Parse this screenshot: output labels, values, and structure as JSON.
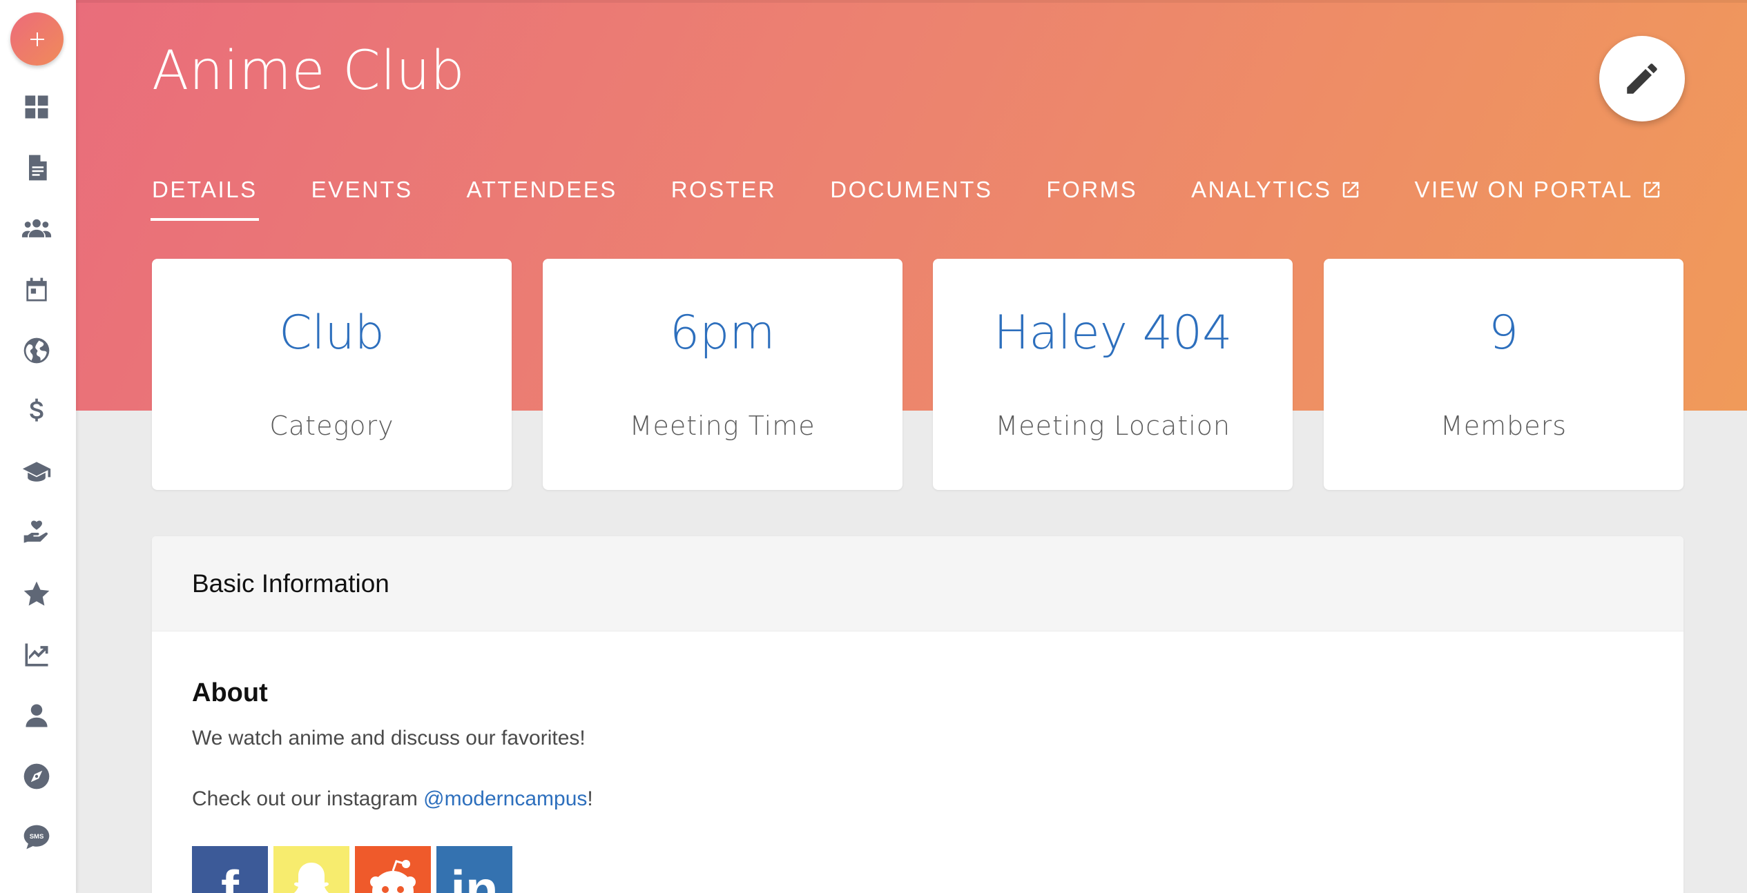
{
  "sidebar": {
    "add_icon": "plus-icon",
    "items": [
      {
        "name": "dashboard",
        "icon": "dashboard-icon"
      },
      {
        "name": "documents",
        "icon": "document-icon"
      },
      {
        "name": "groups",
        "icon": "groups-icon"
      },
      {
        "name": "calendar",
        "icon": "calendar-icon"
      },
      {
        "name": "globe",
        "icon": "globe-icon"
      },
      {
        "name": "finance",
        "icon": "dollar-icon"
      },
      {
        "name": "education",
        "icon": "graduation-cap-icon"
      },
      {
        "name": "volunteer",
        "icon": "hand-heart-icon"
      },
      {
        "name": "favorites",
        "icon": "star-icon"
      },
      {
        "name": "analytics",
        "icon": "trending-up-icon"
      },
      {
        "name": "profile",
        "icon": "person-icon"
      },
      {
        "name": "explore",
        "icon": "compass-icon"
      },
      {
        "name": "sms",
        "icon": "sms-icon"
      }
    ]
  },
  "header": {
    "title": "Anime Club",
    "edit_icon": "pencil-icon",
    "colors": {
      "gradient_start": "#e96d7b",
      "gradient_end": "#f09a5a"
    }
  },
  "tabs": [
    {
      "label": "DETAILS",
      "active": true,
      "external": false
    },
    {
      "label": "EVENTS",
      "active": false,
      "external": false
    },
    {
      "label": "ATTENDEES",
      "active": false,
      "external": false
    },
    {
      "label": "ROSTER",
      "active": false,
      "external": false
    },
    {
      "label": "DOCUMENTS",
      "active": false,
      "external": false
    },
    {
      "label": "FORMS",
      "active": false,
      "external": false
    },
    {
      "label": "ANALYTICS",
      "active": false,
      "external": true
    },
    {
      "label": "VIEW ON PORTAL",
      "active": false,
      "external": true
    }
  ],
  "stats": [
    {
      "value": "Club",
      "caption": "Category"
    },
    {
      "value": "6pm",
      "caption": "Meeting Time"
    },
    {
      "value": "Haley 404",
      "caption": "Meeting Location"
    },
    {
      "value": "9",
      "caption": "Members"
    }
  ],
  "basic_info": {
    "heading": "Basic Information",
    "about_title": "About",
    "about_line1": "We watch anime and discuss our favorites!",
    "about_line2_prefix": "Check out our instagram ",
    "about_line2_link": "@moderncampus",
    "about_line2_suffix": "!",
    "socials": [
      {
        "name": "facebook",
        "glyph": "f",
        "color": "#3c5a98"
      },
      {
        "name": "snapchat",
        "glyph": "",
        "color": "#f7ec6e"
      },
      {
        "name": "reddit",
        "glyph": "",
        "color": "#ef5a2b"
      },
      {
        "name": "linkedin",
        "glyph": "in",
        "color": "#3472b0"
      }
    ]
  },
  "accent_color": "#2d6fbd"
}
